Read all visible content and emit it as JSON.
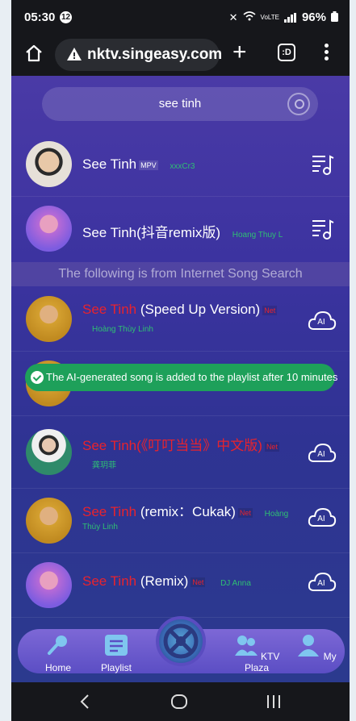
{
  "status_bar": {
    "time": "05:30",
    "notification_count": "12",
    "network": "VoLTE",
    "battery": "96%"
  },
  "browser": {
    "url": "nktv.singeasy.com",
    "tab_icon_label": ":D"
  },
  "search": {
    "query": "see tinh"
  },
  "results": [
    {
      "title": "See Tinh",
      "tag": "MPV",
      "artist": "xxxCr3"
    },
    {
      "title": "See Tinh(抖音remix版)",
      "artist": "Hoang Thuy L"
    }
  ],
  "section_header": "The following is from Internet Song Search",
  "internet_results": [
    {
      "title_highlight": "See Tinh",
      "title_rest": " (Speed Up Version)",
      "tag": "Net",
      "artist": "Hoàng Thùy Linh",
      "ai_badge": "AI"
    },
    {
      "title_highlight": "See Tinh",
      "title_rest": "(《叮叮当当》中文版)",
      "tag": "Net",
      "artist": "龚玥菲",
      "ai_badge": "AI"
    },
    {
      "title_highlight": "See Tinh",
      "title_rest": " (remix：Cukak)",
      "tag": "Net",
      "artist_line1": "Hoàng",
      "artist_line2": "Thùy Linh",
      "ai_badge": "AI"
    },
    {
      "title_highlight": "See Tinh",
      "title_rest": " (Remix)",
      "tag": "Net",
      "artist": "DJ Anna",
      "ai_badge": "AI"
    }
  ],
  "toast": "The AI-generated song is added to the playlist after 10 minutes",
  "bottom_nav": {
    "home": "Home",
    "playlist": "Playlist",
    "ktv_plaza": "KTV Plaza",
    "my": "My"
  },
  "colors": {
    "highlight": "#e8232d",
    "artist": "#2fbf73",
    "toast": "#1ea05a",
    "app_bg": "#3c33a0"
  }
}
